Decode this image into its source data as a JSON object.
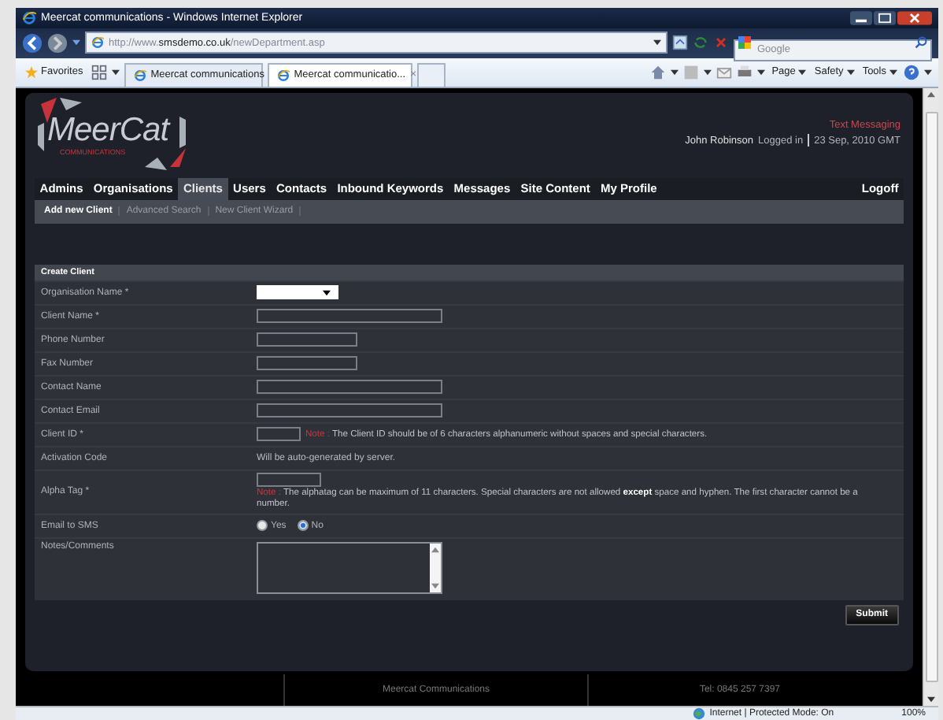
{
  "window": {
    "title": "Meercat communications - Windows Internet Explorer"
  },
  "browser": {
    "address_host_prefix": "http://www.",
    "address_host": "smsdemo.co.uk",
    "address_path": "/newDepartment.asp",
    "search_placeholder": "Google",
    "favorites": "Favorites",
    "tabs": [
      {
        "label": "Meercat communications",
        "selected": false
      },
      {
        "label": "Meercat communicatio...",
        "selected": true,
        "close": "×"
      }
    ],
    "commands": [
      "Page",
      "Safety",
      "Tools"
    ]
  },
  "page": {
    "logo": {
      "name": "MeerCat",
      "tagline": "COMMUNICATIONS"
    },
    "header_title": "Text Messaging",
    "user": "John Robinson",
    "login_status": "Logged in",
    "date": "23 Sep, 2010 GMT",
    "nav": [
      {
        "label": "Admins",
        "selected": false
      },
      {
        "label": "Organisations",
        "selected": false
      },
      {
        "label": "Clients",
        "selected": true
      },
      {
        "label": "Users",
        "selected": false
      },
      {
        "label": "Contacts",
        "selected": false
      },
      {
        "label": "Inbound Keywords",
        "selected": false
      },
      {
        "label": "Messages",
        "selected": false
      },
      {
        "label": "Site Content",
        "selected": false
      },
      {
        "label": "My Profile",
        "selected": false
      }
    ],
    "logoff": "Logoff",
    "subnav": [
      {
        "label": "Add new Client",
        "selected": true
      },
      {
        "label": "Advanced Search",
        "selected": false
      },
      {
        "label": "New Client Wizard",
        "selected": false
      }
    ],
    "form": {
      "title": "Create Client",
      "fields": [
        {
          "kind": "select",
          "label": "Organisation Name *"
        },
        {
          "kind": "text",
          "label": "Client Name *"
        },
        {
          "kind": "short-text",
          "label": "Phone Number"
        },
        {
          "kind": "short-text",
          "label": "Fax Number"
        },
        {
          "kind": "text",
          "label": "Contact Name"
        },
        {
          "kind": "text",
          "label": "Contact Email"
        },
        {
          "kind": "code",
          "label": "Client ID *",
          "note_label": "Note :",
          "note": "The Client ID should be of 6 characters alphanumeric without spaces and special characters."
        },
        {
          "kind": "info",
          "label": "Activation Code",
          "value": "Will be auto-generated by server."
        },
        {
          "kind": "tag",
          "label": "Alpha Tag *",
          "note_label": "Note :",
          "note": "The alphatag can be maximum of 11 characters. Special characters are not allowed **except** space and hyphen. The first character cannot be a number."
        },
        {
          "kind": "radio",
          "label": "Email to SMS",
          "options": [
            {
              "label": "Yes",
              "selected": false
            },
            {
              "label": "No",
              "selected": true
            }
          ]
        },
        {
          "kind": "textarea",
          "label": "Notes/Comments"
        }
      ],
      "submit": "Submit"
    },
    "footer": [
      "Meercat Communications",
      "Tel: 0845 257 7397"
    ]
  },
  "status_bar": {
    "zone": "Internet | Protected Mode: On",
    "zoom": "100%"
  }
}
